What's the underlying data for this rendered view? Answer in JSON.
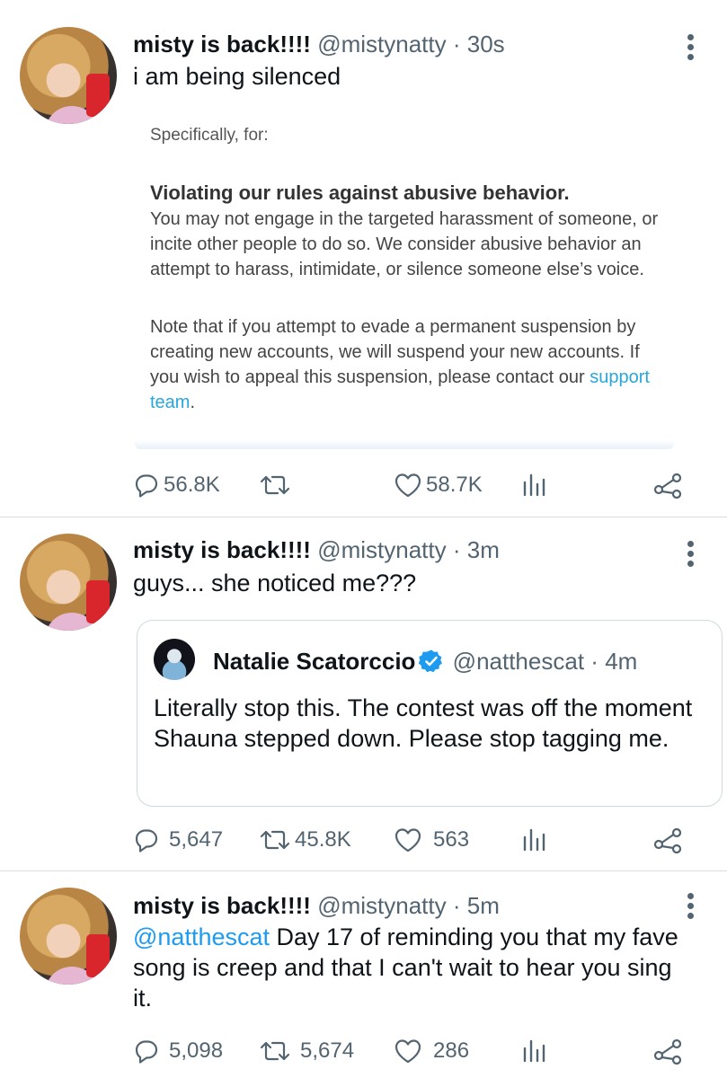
{
  "tweets": [
    {
      "name": "misty is back!!!!",
      "handle": "@mistynatty",
      "separator": "·",
      "time": "30s",
      "text": "i am being silenced",
      "image": {
        "specifically": "Specifically, for:",
        "rule_title": "Violating our rules against abusive behavior.",
        "rule_body": "You may not engage in the targeted harassment of someone, or incite other people to do so. We consider abusive behavior an attempt to harass, intimidate, or silence someone else’s voice.",
        "note": "Note that if you attempt to evade a permanent suspension by creating new accounts, we will suspend your new accounts. If you wish to appeal this suspension, please contact our",
        "link": "support team",
        "period": "."
      },
      "replies": "56.8K",
      "retweets": "",
      "likes": "58.7K"
    },
    {
      "name": "misty is back!!!!",
      "handle": "@mistynatty",
      "separator": "·",
      "time": "3m",
      "text": "guys... she noticed me???",
      "quote": {
        "name": "Natalie Scatorccio",
        "handle": "@natthescat",
        "separator": "·",
        "time": "4m",
        "text": "Literally stop this. The contest was off the moment Shauna stepped down. Please stop tagging me."
      },
      "replies": "5,647",
      "retweets": "45.8K",
      "likes": "563"
    },
    {
      "name": "misty is back!!!!",
      "handle": "@mistynatty",
      "separator": "·",
      "time": "5m",
      "mention": "@natthescat",
      "text": " Day 17 of reminding you that my fave song is creep and that I can't wait to hear you sing it.",
      "replies": "5,098",
      "retweets": "5,674",
      "likes": "286"
    }
  ],
  "colors": {
    "accent": "#1d9bf0",
    "muted": "#536471",
    "link_in_image": "#29a6db",
    "verified": "#1d9bf0"
  },
  "icons": [
    "more-icon",
    "reply-icon",
    "retweet-icon",
    "like-icon",
    "analytics-icon",
    "share-icon",
    "verified-icon"
  ]
}
